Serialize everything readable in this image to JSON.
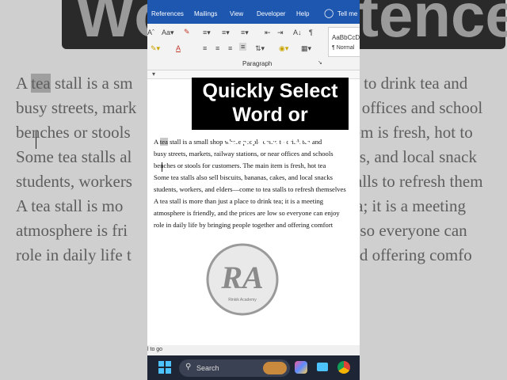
{
  "background": {
    "title_left": "Wo",
    "title_right": "tence",
    "lines": [
      [
        "A ",
        "tea",
        " stall is a sm",
        "",
        "ne to drink tea and"
      ],
      [
        "busy streets, mark",
        "",
        "",
        "",
        "or offices and school"
      ],
      [
        "benches or stools",
        "",
        "",
        "",
        "item is fresh, hot to"
      ],
      [
        "Some tea stalls al",
        "",
        "",
        "",
        "kes, and local snack"
      ],
      [
        "students, workers",
        "",
        "",
        "",
        "stalls to refresh them"
      ],
      [
        "A tea stall is mo",
        "",
        "",
        "",
        "tea; it is a meeting"
      ],
      [
        "atmosphere is fri",
        "",
        "",
        "",
        "w so everyone can"
      ],
      [
        "role in daily life t",
        "",
        "",
        "",
        "and offering comfo"
      ]
    ]
  },
  "ribbon": {
    "tabs": [
      "References",
      "Mailings",
      "View",
      "Developer",
      "Help"
    ],
    "tell_me": "Tell me",
    "paragraph_label": "Paragraph",
    "style_sample": "AaBbCcD",
    "style_name": "¶ Normal"
  },
  "overlay": {
    "line1": "Quickly Select",
    "line2": "Word or Sentence"
  },
  "document": {
    "line0_pre": "A ",
    "line0_hl": "tea",
    "line0_post": " stall is a small shop where people come to drink tea and",
    "lines": [
      "busy streets, markets, railway stations, or near offices and schools",
      "benches or stools for customers. The main item is fresh, hot tea",
      "Some tea stalls also sell biscuits, bananas, cakes, and local snacks",
      "students, workers, and elders—come to tea stalls to refresh themselves",
      "A tea stall is more than just a place to drink tea; it is a meeting",
      "atmosphere is friendly, and the prices are low so everyone can enjoy",
      "role in daily life by bringing people together and offering comfort"
    ]
  },
  "logo": {
    "letters": "RA",
    "caption": "Rinkik Academy"
  },
  "status_bar": {
    "text": "l to go"
  },
  "taskbar": {
    "search_placeholder": "Search"
  },
  "colors": {
    "word_blue": "#1e57b0",
    "taskbar": "#1e2535",
    "overlay_bg": "#000000",
    "overlay_text": "#ffffff"
  }
}
